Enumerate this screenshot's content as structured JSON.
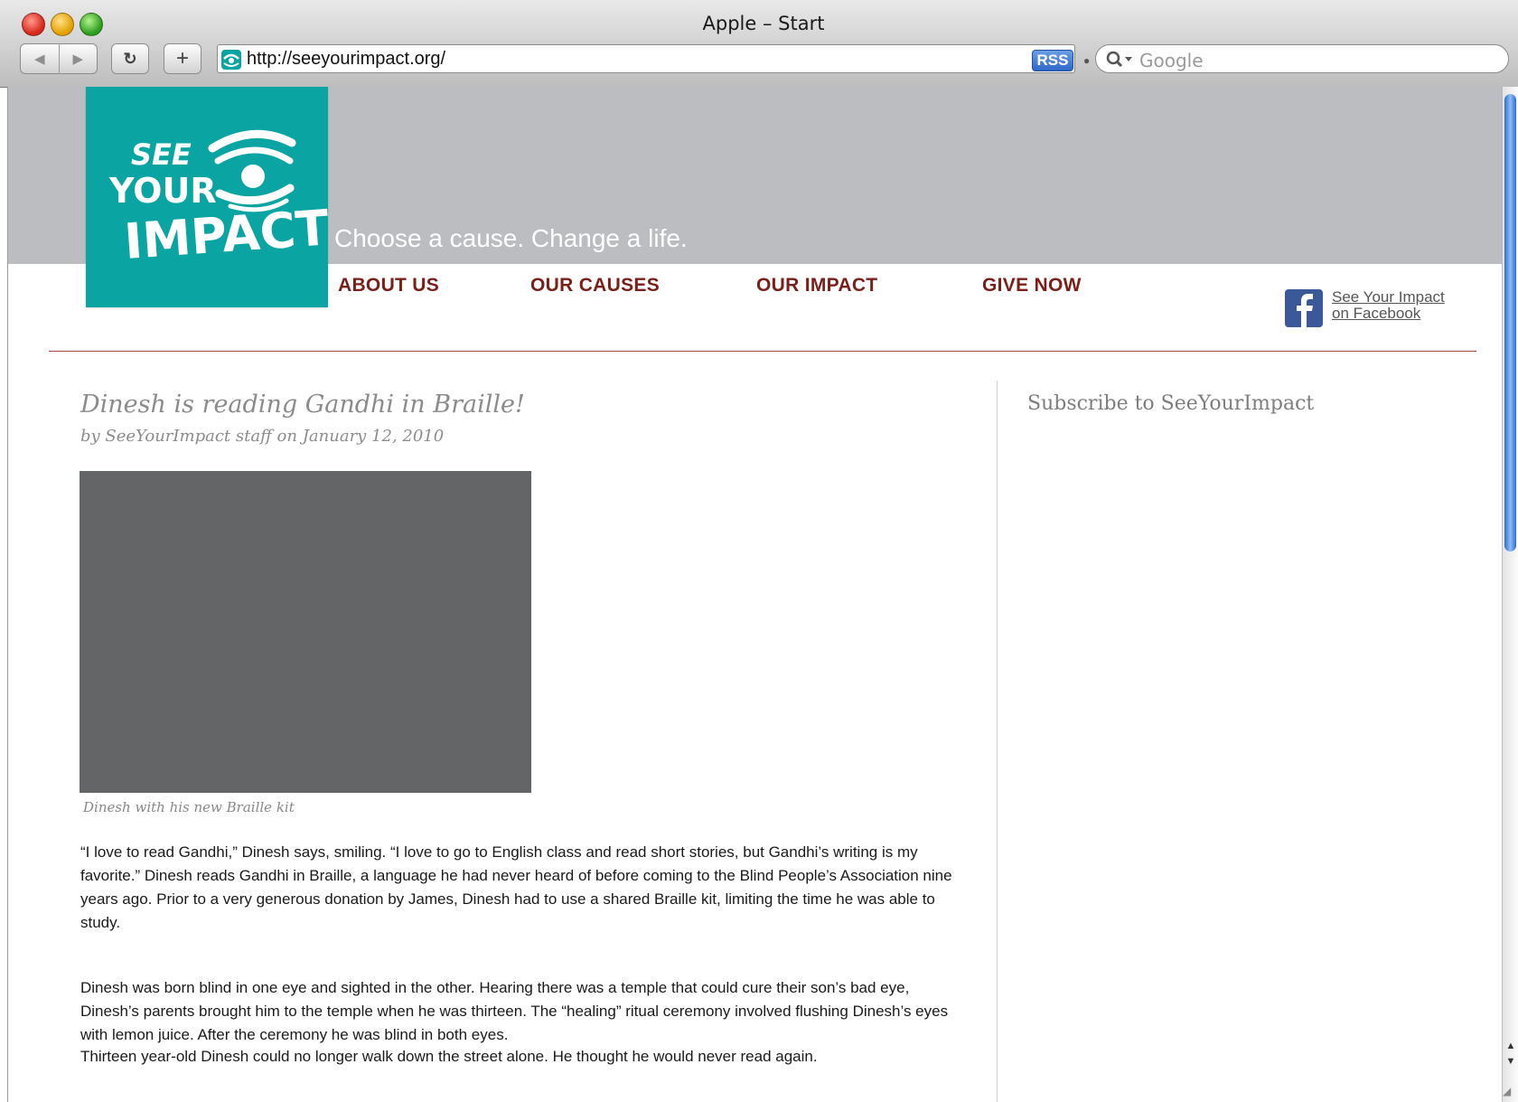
{
  "window": {
    "title": "Apple – Start"
  },
  "toolbar": {
    "back_label": "◀",
    "forward_label": "▶",
    "reload_label": "↻",
    "add_label": "+",
    "url": "http://seeyourimpact.org/",
    "rss_label": "RSS",
    "search_placeholder": "Google"
  },
  "site": {
    "logo_text": [
      "SEE",
      "YOUR",
      "IMPACT"
    ],
    "tagline": "Choose a cause. Change a life.",
    "nav": [
      "ABOUT US",
      "OUR CAUSES",
      "OUR IMPACT",
      "GIVE NOW"
    ],
    "facebook_link": [
      "See Your Impact",
      "on Facebook"
    ],
    "brand_color": "#0aa5a2",
    "nav_color": "#7a1f1a"
  },
  "post": {
    "title": "Dinesh is reading Gandhi in Braille!",
    "byline": "by SeeYourImpact staff on January 12, 2010",
    "image_caption": "Dinesh with his new Braille kit",
    "paragraphs": [
      "“I love to read Gandhi,” Dinesh says, smiling. “I love to go to English class and read short stories, but Gandhi’s writing is my favorite.” Dinesh reads Gandhi in Braille, a language he had never heard of before coming to the Blind People’s Association nine years ago. Prior to a very generous donation by James, Dinesh had to use a shared Braille kit, limiting the time he was able to study.",
      "Dinesh was born blind in one eye and sighted in the other. Hearing there was a temple that could cure their son’s bad eye, Dinesh’s parents brought him to the temple when he was thirteen. The “healing” ritual ceremony involved flushing Dinesh’s eyes with lemon juice. After the ceremony he was blind in both eyes.",
      "Thirteen year-old Dinesh could no longer walk down the street alone. He thought he would never read again."
    ]
  },
  "sidebar": {
    "heading": "Subscribe to SeeYourImpact"
  }
}
